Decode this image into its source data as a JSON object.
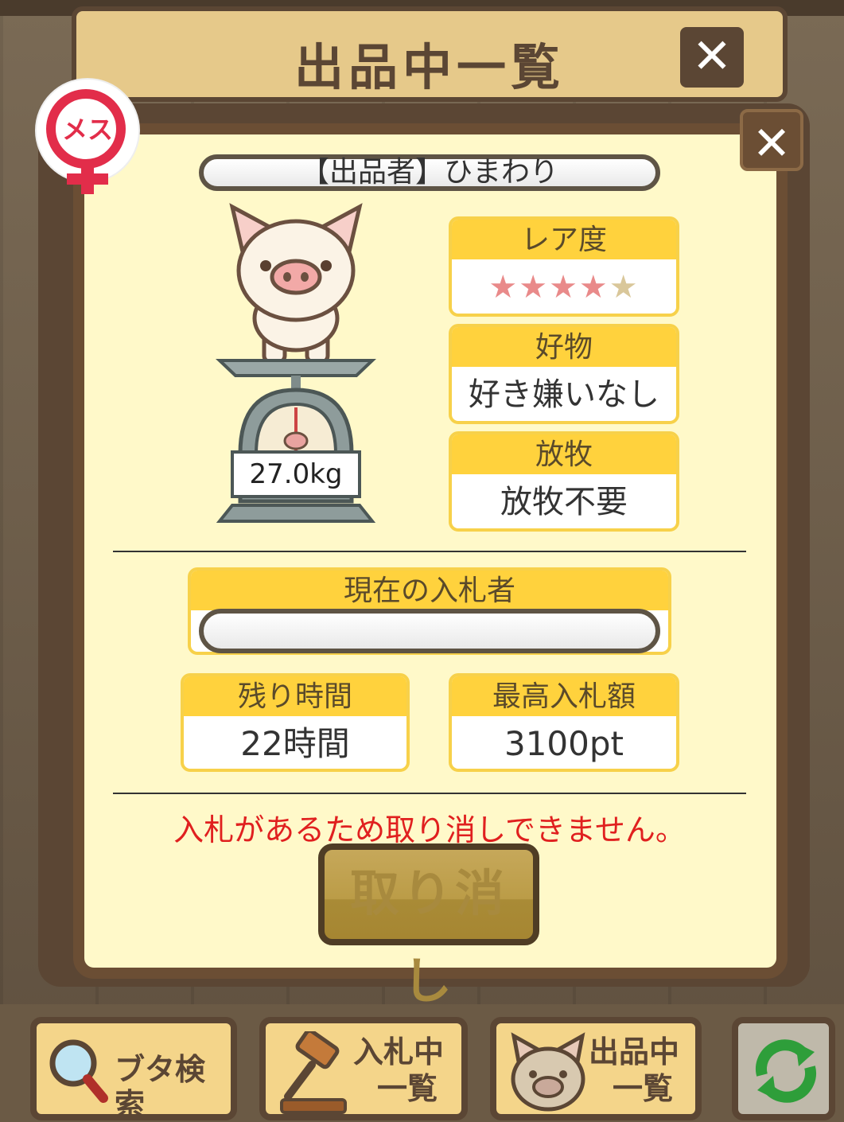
{
  "back_panel": {
    "title": "出品中一覧",
    "close_label": "✕"
  },
  "dialog": {
    "close_label": "✕",
    "gender_badge": "メス",
    "seller": "【出品者】ひまわり",
    "pig_weight": "27.0kg",
    "rarity": {
      "label": "レア度",
      "stars_filled": 4,
      "stars_total": 5,
      "filled_glyphs": "★★★★",
      "empty_glyphs": "★"
    },
    "favorite_food": {
      "label": "好物",
      "value": "好き嫌いなし"
    },
    "grazing": {
      "label": "放牧",
      "value": "放牧不要"
    },
    "current_bidder": {
      "label": "現在の入札者",
      "value": ""
    },
    "time_left": {
      "label": "残り時間",
      "value": "22時間"
    },
    "highest_bid": {
      "label": "最高入札額",
      "value": "3100pt"
    },
    "warning": "入札があるため取り消しできません。",
    "cancel_label": "取り消し"
  },
  "toolbar": {
    "search_label": "ブタ検索",
    "bidding_label_1": "入札中",
    "bidding_label_2": "一覧",
    "listing_label_1": "出品中",
    "listing_label_2": "一覧"
  },
  "colors": {
    "dialog_bg": "#fff9c9",
    "frame_brown": "#6b4e34",
    "header_yellow": "#ffd23d",
    "warning_red": "#e0201f",
    "female_red": "#e22d4a"
  },
  "icons": [
    "search-icon",
    "gavel-icon",
    "pig-face-icon",
    "refresh-icon"
  ]
}
